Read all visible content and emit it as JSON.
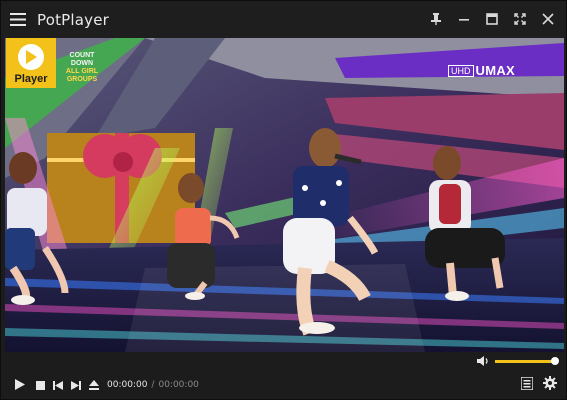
{
  "window": {
    "title": "PotPlayer"
  },
  "logo": {
    "label": "Player"
  },
  "video": {
    "channel_logo_line1": "COUNT",
    "channel_logo_line2": "DOWN",
    "channel_logo_line3": "ALL GIRL GROUPS",
    "quality_badge": "UHD",
    "brand_badge": "UMAX"
  },
  "playback": {
    "current_time": "00:00:00",
    "separator": "/",
    "total_time": "00:00:00",
    "volume_fraction": 1.0
  },
  "colors": {
    "accent": "#f3c21a",
    "titlebar": "#1e1e1e",
    "text": "#e9e9e9"
  },
  "icons": {
    "menu": "hamburger-icon",
    "pin": "pin-icon",
    "minimize": "minimize-icon",
    "maximize": "maximize-icon",
    "fullscreen": "fullscreen-icon",
    "close": "close-icon",
    "play": "play-icon",
    "stop": "stop-icon",
    "previous": "previous-icon",
    "next": "next-icon",
    "eject": "eject-icon",
    "volume": "volume-icon",
    "playlist": "playlist-icon",
    "settings": "gear-icon"
  }
}
